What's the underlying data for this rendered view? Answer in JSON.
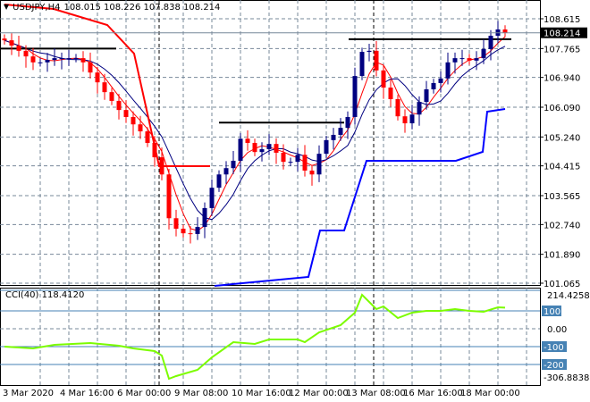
{
  "header": {
    "symbol": "USDJPY,H4",
    "ohlc": "108.015 108.226 107.838 108.214"
  },
  "colors": {
    "bull": "#000080",
    "bear": "#ff0000",
    "ma_fast": "#ff0000",
    "ma_slow": "#000080",
    "cci": "#7cfc00",
    "level": "#4682b4"
  },
  "price_axis": {
    "labels": [
      "108.615",
      "107.765",
      "106.940",
      "106.090",
      "105.240",
      "104.415",
      "103.565",
      "102.740",
      "101.890",
      "101.065"
    ],
    "current": "108.214",
    "max": 108.615,
    "min": 101.065
  },
  "cci_panel": {
    "title": "CCI(40) 118.4120",
    "labels": [
      "0.00"
    ],
    "level_labels": [
      "100",
      "-100",
      "-200"
    ],
    "top_label": "214.4258",
    "bottom_label": "-306.8838",
    "max": 226,
    "min": -306.8838
  },
  "time_axis": [
    "3 Mar 2020",
    "4 Mar 16:00",
    "6 Mar 00:00",
    "9 Mar 08:00",
    "10 Mar 16:00",
    "12 Mar 00:00",
    "13 Mar 08:00",
    "16 Mar 16:00",
    "18 Mar 00:00"
  ],
  "chart_data": {
    "type": "candlestick",
    "closes": [
      108.0,
      107.85,
      107.7,
      107.54,
      107.37,
      107.37,
      107.44,
      107.49,
      107.49,
      107.49,
      107.49,
      107.37,
      107.08,
      106.8,
      106.52,
      106.27,
      106.01,
      105.81,
      105.6,
      105.4,
      105.07,
      104.66,
      104.17,
      102.92,
      102.62,
      102.49,
      102.47,
      102.67,
      103.21,
      103.79,
      104.17,
      104.35,
      104.56,
      105.19,
      105.07,
      104.81,
      104.89,
      105.04,
      104.79,
      104.53,
      104.53,
      104.73,
      104.28,
      104.17,
      104.76,
      105.15,
      105.3,
      105.5,
      105.81,
      106.98,
      107.67,
      107.7,
      107.14,
      106.65,
      106.32,
      105.83,
      105.63,
      105.88,
      106.24,
      106.6,
      106.78,
      106.91,
      107.37,
      107.49,
      107.49,
      107.42,
      107.49,
      107.75,
      108.13,
      108.31,
      108.214
    ],
    "cci_points": [
      [
        0,
        -100
      ],
      [
        4,
        -110
      ],
      [
        7,
        -90
      ],
      [
        12,
        -80
      ],
      [
        16,
        -95
      ],
      [
        18,
        -110
      ],
      [
        21,
        -125
      ],
      [
        22,
        -150
      ],
      [
        23,
        -280
      ],
      [
        24,
        -265
      ],
      [
        27,
        -230
      ],
      [
        29,
        -160
      ],
      [
        32,
        -75
      ],
      [
        35,
        -85
      ],
      [
        37,
        -60
      ],
      [
        41,
        -60
      ],
      [
        42,
        -75
      ],
      [
        44,
        -20
      ],
      [
        47,
        20
      ],
      [
        49,
        90
      ],
      [
        50,
        190
      ],
      [
        52,
        110
      ],
      [
        53,
        125
      ],
      [
        55,
        60
      ],
      [
        57,
        90
      ],
      [
        59,
        100
      ],
      [
        61,
        100
      ],
      [
        63,
        110
      ],
      [
        65,
        100
      ],
      [
        67,
        95
      ],
      [
        69,
        120
      ],
      [
        70,
        118.412
      ]
    ],
    "resistance_levels": [
      107.765,
      105.65,
      108.03
    ]
  }
}
